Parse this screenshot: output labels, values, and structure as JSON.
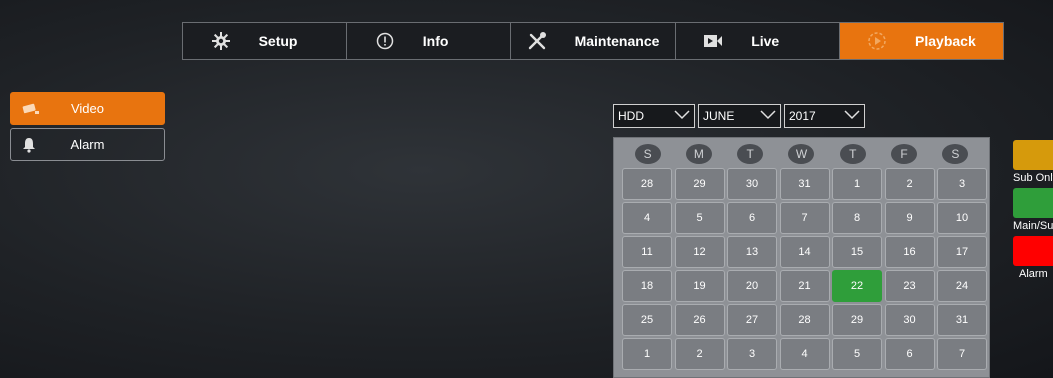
{
  "tabs": [
    {
      "label": "Setup",
      "icon": "gear-icon"
    },
    {
      "label": "Info",
      "icon": "info-circle-icon"
    },
    {
      "label": "Maintenance",
      "icon": "tools-icon"
    },
    {
      "label": "Live",
      "icon": "video-camera-icon"
    },
    {
      "label": "Playback",
      "icon": "playback-icon",
      "active": true
    }
  ],
  "sidebar": {
    "items": [
      {
        "label": "Video",
        "icon": "camera-icon",
        "active": true
      },
      {
        "label": "Alarm",
        "icon": "bell-icon"
      }
    ]
  },
  "filters": {
    "storage": "HDD",
    "month": "JUNE",
    "year": "2017"
  },
  "calendar": {
    "weekdays": [
      "S",
      "M",
      "T",
      "W",
      "T",
      "F",
      "S"
    ],
    "highlight_color": "#2f9e3a",
    "weeks": [
      [
        "28",
        "29",
        "30",
        "31",
        "1",
        "2",
        "3"
      ],
      [
        "4",
        "5",
        "6",
        "7",
        "8",
        "9",
        "10"
      ],
      [
        "11",
        "12",
        "13",
        "14",
        "15",
        "16",
        "17"
      ],
      [
        "18",
        "19",
        "20",
        "21",
        "22",
        "23",
        "24"
      ],
      [
        "25",
        "26",
        "27",
        "28",
        "29",
        "30",
        "31"
      ],
      [
        "1",
        "2",
        "3",
        "4",
        "5",
        "6",
        "7"
      ]
    ],
    "highlighted_day": "22"
  },
  "legend": [
    {
      "label": "Sub Only",
      "color": "#d69a0c"
    },
    {
      "label": "Main/Sub",
      "color": "#2f9e3a"
    },
    {
      "label": "Alarm",
      "color": "#ff0000"
    }
  ],
  "accent": "#e8740f"
}
